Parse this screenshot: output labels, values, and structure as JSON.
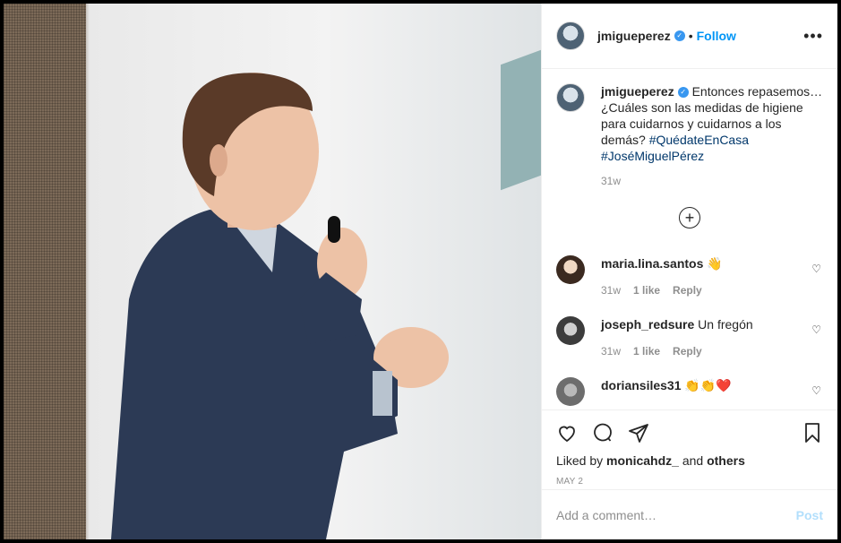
{
  "header": {
    "username": "jmigueperez",
    "separator": "•",
    "follow_label": "Follow",
    "more_label": "•••"
  },
  "caption": {
    "username": "jmigueperez",
    "text": "Entonces repasemos… ¿Cuáles son las medidas de higiene para cuidarnos y cuidarnos a los demás?",
    "hashtag1": "#QuédateEnCasa",
    "hashtag2": "#JoséMiguelPérez",
    "time": "31w"
  },
  "load_more_label": "+",
  "comments": [
    {
      "username": "maria.lina.santos",
      "text": "👋",
      "time": "31w",
      "likes": "1 like",
      "reply": "Reply"
    },
    {
      "username": "joseph_redsure",
      "text": "Un fregón",
      "time": "31w",
      "likes": "1 like",
      "reply": "Reply"
    },
    {
      "username": "doriansiles31",
      "text": "👏👏❤️",
      "time": "",
      "likes": "",
      "reply": ""
    }
  ],
  "likes": {
    "prefix": "Liked by",
    "user": "monicahdz_",
    "connector": "and",
    "others": "others"
  },
  "date": "MAY 2",
  "add_comment": {
    "placeholder": "Add a comment…",
    "post_label": "Post"
  },
  "colors": {
    "link": "#0095f6",
    "hashtag": "#00376b",
    "muted": "#8e8e8e",
    "post_disabled": "#b2dffc"
  }
}
